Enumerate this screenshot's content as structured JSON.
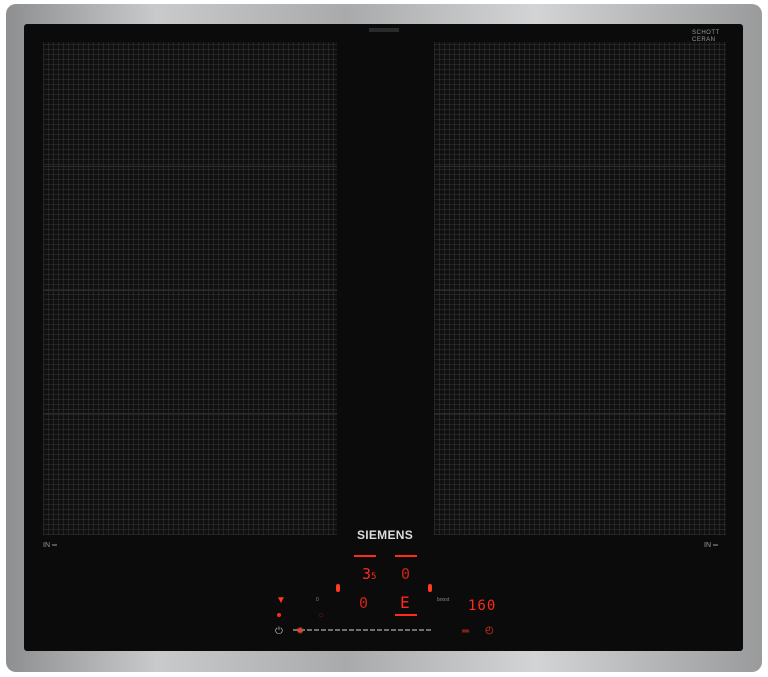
{
  "brand": {
    "name": "SIEMENS",
    "glass_maker_line1": "SCHOTT",
    "glass_maker_line2": "CERAN"
  },
  "zones": [
    {
      "id": "left",
      "flex_label": "IN"
    },
    {
      "id": "right",
      "flex_label": "IN"
    }
  ],
  "controls": {
    "power_level_front": "3",
    "power_level_front_sub": "5",
    "power_level_rear": "0",
    "power_level_mid": "0",
    "power_level_right": "E",
    "timer_readout": "160",
    "slider_min_label": "0",
    "slider_max_label": "boost"
  },
  "colors": {
    "glass": "#0b0b0c",
    "display_red": "#ff2a1a",
    "frame": "#b5b6b7"
  },
  "icons": [
    "power-icon",
    "lock-icon",
    "pan-left-icon",
    "pan-right-icon",
    "wifi-icon",
    "timer-icon",
    "frying-sensor-icon"
  ]
}
